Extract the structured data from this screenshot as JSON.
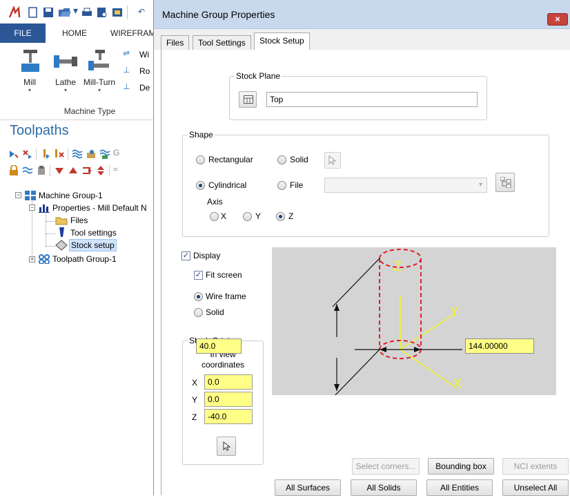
{
  "ribbon": {
    "tabs": [
      "FILE",
      "HOME",
      "WIREFRAM"
    ],
    "machine_buttons": [
      "Mill",
      "Lathe",
      "Mill-Turn"
    ],
    "small_items": [
      "Wi",
      "Ro",
      "De"
    ],
    "group_label": "Machine Type"
  },
  "toolpaths": {
    "title": "Toolpaths",
    "tree": {
      "machine_group": "Machine Group-1",
      "properties": "Properties - Mill Default N",
      "files": "Files",
      "tool_settings": "Tool settings",
      "stock_setup": "Stock setup",
      "toolpath_group": "Toolpath Group-1"
    }
  },
  "dialog": {
    "title": "Machine Group Properties",
    "close_glyph": "×",
    "tabs": [
      "Files",
      "Tool Settings",
      "Stock Setup"
    ],
    "active_tab": "Stock Setup",
    "stock_plane": {
      "label": "Stock Plane",
      "value": "Top"
    },
    "shape": {
      "label": "Shape",
      "rectangular": "Rectangular",
      "solid": "Solid",
      "cylindrical": "Cylindrical",
      "file": "File",
      "selected": "Cylindrical",
      "axis_label": "Axis",
      "axis_options": [
        "X",
        "Y",
        "Z"
      ],
      "axis_selected": "Z"
    },
    "display": {
      "display_label": "Display",
      "display_checked": true,
      "fit_screen_label": "Fit screen",
      "fit_screen_checked": true,
      "wire_frame_label": "Wire frame",
      "solid_label": "Solid",
      "render_mode": "Wire frame"
    },
    "stock_origin": {
      "label": "Stock Origin",
      "subtitle_line1": "In view",
      "subtitle_line2": "coordinates",
      "x_label": "X",
      "x": "0.0",
      "y_label": "Y",
      "y": "0.0",
      "z_label": "Z",
      "z": "-40.0"
    },
    "preview": {
      "height_value": "40.0",
      "diameter_value": "144.00000",
      "axis_labels": [
        "Z",
        "Y",
        "X"
      ]
    },
    "buttons": {
      "select_corners": "Select corners...",
      "bounding_box": "Bounding box",
      "nci_extents": "NCI extents",
      "all_surfaces": "All Surfaces",
      "all_solids": "All Solids",
      "all_entities": "All Entities",
      "unselect_all": "Unselect All"
    }
  },
  "colors": {
    "accent_blue": "#2b5797",
    "toolpaths_title": "#2e6ca6",
    "input_yellow": "#ffff88",
    "stock_red": "#e0202a",
    "axis_yellow": "#f2f230"
  }
}
